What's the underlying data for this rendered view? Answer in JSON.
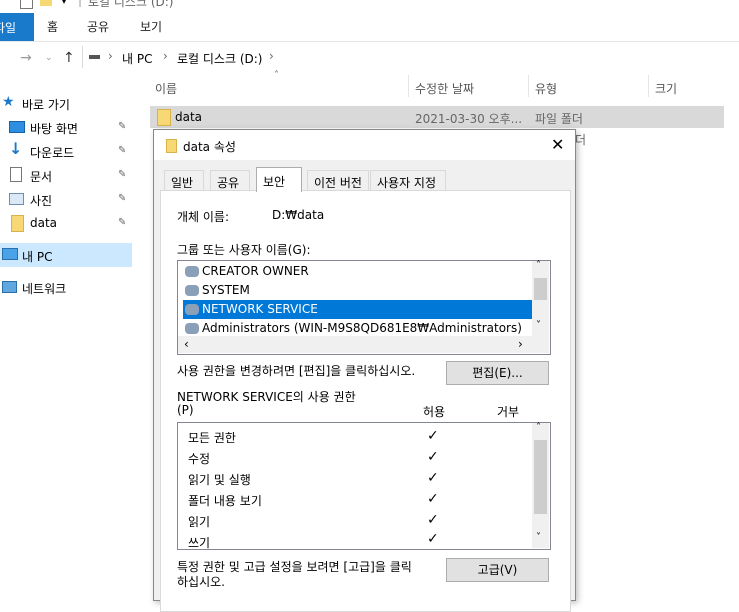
{
  "window": {
    "title": "로컬 디스크 (D:)"
  },
  "ribbon": {
    "tabs": [
      "파일",
      "홈",
      "공유",
      "보기"
    ]
  },
  "address": {
    "path": [
      "내 PC",
      "로컬 디스크 (D:)"
    ]
  },
  "nav": {
    "quick_access": "바로 가기",
    "items": [
      "바탕 화면",
      "다운로드",
      "문서",
      "사진",
      "data"
    ],
    "this_pc": "내 PC",
    "network": "네트워크"
  },
  "list": {
    "columns": [
      "이름",
      "수정한 날짜",
      "유형",
      "크기"
    ],
    "rows": [
      {
        "name": "data",
        "date": "2021-03-30 오후...",
        "type": "파일 폴더"
      }
    ],
    "partial_type": "더"
  },
  "dialog": {
    "title": "data 속성",
    "tabs": [
      "일반",
      "공유",
      "보안",
      "이전 버전",
      "사용자 지정"
    ],
    "object_label": "개체 이름:",
    "object_value": "D:₩data",
    "groups_label": "그룹 또는 사용자 이름(G):",
    "groups": [
      "CREATOR OWNER",
      "SYSTEM",
      "NETWORK SERVICE",
      "Administrators (WIN-M9S8QD681E8₩Administrators)"
    ],
    "edit_text": "사용 권한을 변경하려면 [편집]을 클릭하십시오.",
    "edit_button": "편집(E)...",
    "perm_label_1": "NETWORK SERVICE의 사용 권한",
    "perm_label_2": "(P)",
    "allow": "허용",
    "deny": "거부",
    "permissions": [
      "모든 권한",
      "수정",
      "읽기 및 실행",
      "폴더 내용 보기",
      "읽기",
      "쓰기"
    ],
    "advanced_text_1": "특정 권한 및 고급 설정을 보려면 [고급]을 클릭",
    "advanced_text_2": "하십시오.",
    "advanced_button": "고급(V)"
  }
}
